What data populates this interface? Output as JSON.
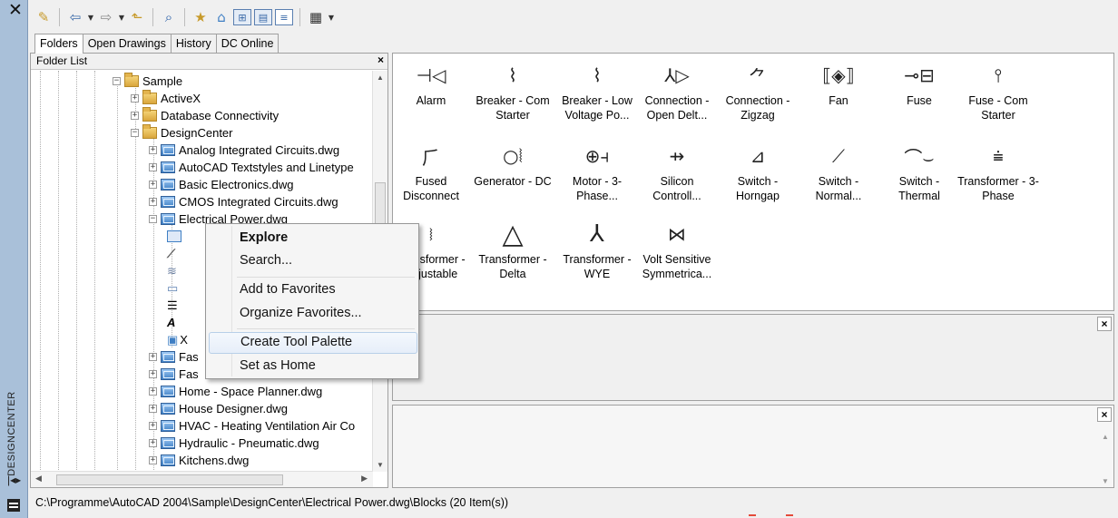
{
  "window": {
    "palette_title": "DESIGNCENTER",
    "close_glyph": "✕"
  },
  "tabs": [
    {
      "label": "Folders",
      "active": true
    },
    {
      "label": "Open Drawings",
      "active": false
    },
    {
      "label": "History",
      "active": false
    },
    {
      "label": "DC Online",
      "active": false
    }
  ],
  "folder_list": {
    "header": "Folder List",
    "close_glyph": "×",
    "items": [
      {
        "label": "Sample",
        "icon": "folder-icon",
        "expander": "−"
      },
      {
        "label": "ActiveX",
        "icon": "folder-icon",
        "expander": "+"
      },
      {
        "label": "Database Connectivity",
        "icon": "folder-icon",
        "expander": "+"
      },
      {
        "label": "DesignCenter",
        "icon": "folder-icon",
        "expander": "−"
      },
      {
        "label": "Analog Integrated Circuits.dwg",
        "icon": "drawing-icon",
        "expander": "+"
      },
      {
        "label": "AutoCAD Textstyles and Linetype",
        "icon": "drawing-icon",
        "expander": "+"
      },
      {
        "label": "Basic Electronics.dwg",
        "icon": "drawing-icon",
        "expander": "+"
      },
      {
        "label": "CMOS Integrated Circuits.dwg",
        "icon": "drawing-icon",
        "expander": "+"
      },
      {
        "label": "Electrical Power.dwg",
        "icon": "drawing-icon",
        "expander": "−"
      },
      {
        "label": "Fas",
        "icon": "drawing-icon",
        "expander": "+"
      },
      {
        "label": "Fas",
        "icon": "drawing-icon",
        "expander": "+"
      },
      {
        "label": "Home - Space Planner.dwg",
        "icon": "drawing-icon",
        "expander": "+"
      },
      {
        "label": "House Designer.dwg",
        "icon": "drawing-icon",
        "expander": "+"
      },
      {
        "label": "HVAC - Heating Ventilation Air Co",
        "icon": "drawing-icon",
        "expander": "+"
      },
      {
        "label": "Hydraulic - Pneumatic.dwg",
        "icon": "drawing-icon",
        "expander": "+"
      },
      {
        "label": "Kitchens.dwg",
        "icon": "drawing-icon",
        "expander": "+"
      }
    ],
    "child_node_glyphs": [
      "⇄",
      "⟋",
      "≋",
      "▭",
      "☰",
      "A",
      "▣"
    ],
    "child_node_partial_label": "X"
  },
  "blocks": [
    {
      "label": "Alarm",
      "icon": "alarm-icon",
      "glyph": "⊣◁"
    },
    {
      "label": "Breaker - Com Starter",
      "icon": "breaker-com-starter-icon",
      "glyph": "⌇"
    },
    {
      "label": "Breaker - Low Voltage Po...",
      "icon": "breaker-low-voltage-icon",
      "glyph": "⌇"
    },
    {
      "label": "Connection - Open Delt...",
      "icon": "connection-open-delta-icon",
      "glyph": "⅄▷"
    },
    {
      "label": "Connection - Zigzag",
      "icon": "connection-zigzag-icon",
      "glyph": "⺈"
    },
    {
      "label": "Fan",
      "icon": "fan-icon",
      "glyph": "⟦◈⟧"
    },
    {
      "label": "Fuse",
      "icon": "fuse-icon",
      "glyph": "⊸⊟"
    },
    {
      "label": "Fuse - Com Starter",
      "icon": "fuse-com-starter-icon",
      "glyph": "⫯"
    },
    {
      "label": "Fused Disconnect",
      "icon": "fused-disconnect-icon",
      "glyph": "⺁"
    },
    {
      "label": "Generator - DC",
      "icon": "generator-dc-icon",
      "glyph": "○⦚"
    },
    {
      "label": "Motor - 3-Phase...",
      "icon": "motor-3-phase-icon",
      "glyph": "⊕⫞"
    },
    {
      "label": "Silicon Controll...",
      "icon": "silicon-controlled-icon",
      "glyph": "⇸"
    },
    {
      "label": "Switch - Horngap",
      "icon": "switch-horngap-icon",
      "glyph": "⊿"
    },
    {
      "label": "Switch - Normal...",
      "icon": "switch-normal-icon",
      "glyph": "⟋"
    },
    {
      "label": "Switch - Thermal",
      "icon": "switch-thermal-icon",
      "glyph": "⌒⌣"
    },
    {
      "label": "Transformer - 3-Phase",
      "icon": "transformer-3-phase-icon",
      "glyph": "⩧"
    },
    {
      "label": "Transformer - Adjustable",
      "icon": "transformer-adjustable-icon",
      "glyph": "⧘"
    },
    {
      "label": "Transformer - Delta",
      "icon": "transformer-delta-icon",
      "glyph": "△"
    },
    {
      "label": "Transformer - WYE",
      "icon": "transformer-wye-icon",
      "glyph": "⅄"
    },
    {
      "label": "Volt Sensitive Symmetrica...",
      "icon": "volt-sensitive-icon",
      "glyph": "⋈"
    }
  ],
  "context_menu": {
    "items": [
      {
        "label": "Explore",
        "bold": true
      },
      {
        "label": "Search...",
        "bold": false
      },
      {
        "label": "Add to Favorites",
        "bold": false
      },
      {
        "label": "Organize Favorites...",
        "bold": false
      },
      {
        "label": "Create Tool Palette",
        "bold": false,
        "highlighted": true
      },
      {
        "label": "Set as Home",
        "bold": false
      }
    ]
  },
  "panels": {
    "preview_close": "×",
    "description_close": "×"
  },
  "status_bar": {
    "path": "C:\\Programme\\AutoCAD 2004\\Sample\\DesignCenter\\Electrical Power.dwg\\Blocks (20 Item(s))"
  },
  "colors": {
    "titlebar": "#a9c0d9",
    "menu_highlight": "#e6eef9",
    "accent_red": "#e34a3a"
  }
}
